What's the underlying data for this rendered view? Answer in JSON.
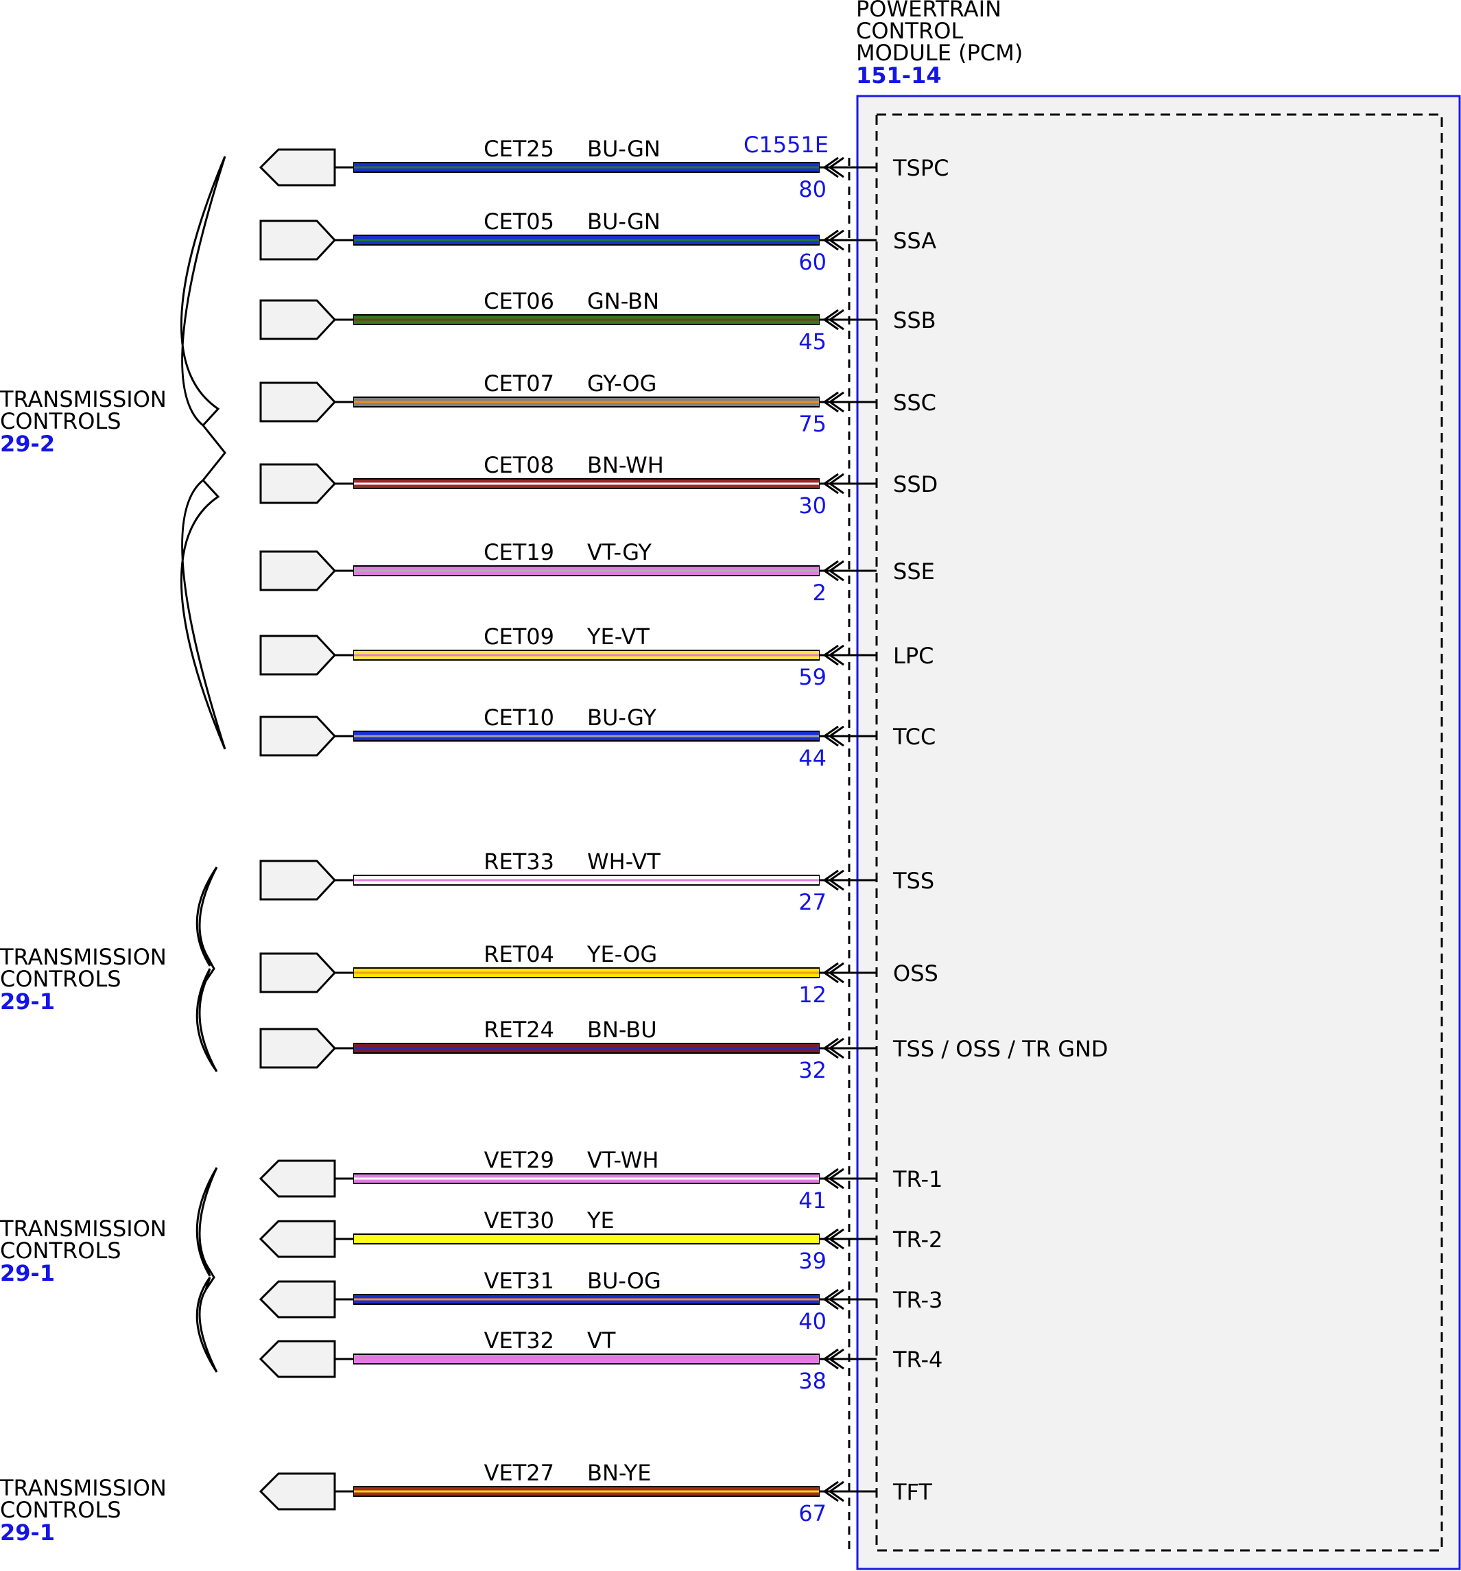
{
  "module": {
    "title_lines": [
      "POWERTRAIN",
      "CONTROL",
      "MODULE (PCM)"
    ],
    "ref": "151-14",
    "connector": "C1551E",
    "colors": {
      "border": "#1a1ae6",
      "fill": "#f2f2f2",
      "link": "#1414e6"
    }
  },
  "wires": [
    {
      "circuit": "CET25",
      "color_code": "BU-GN",
      "pin": "80",
      "signal": "TSPC",
      "dir": "left",
      "colors": [
        "#1a2fd0",
        "#1e7a2a"
      ]
    },
    {
      "circuit": "CET05",
      "color_code": "BU-GN",
      "pin": "60",
      "signal": "SSA",
      "dir": "right",
      "colors": [
        "#1a2fd0",
        "#1e7a2a"
      ]
    },
    {
      "circuit": "CET06",
      "color_code": "GN-BN",
      "pin": "45",
      "signal": "SSB",
      "dir": "right",
      "colors": [
        "#2e7d1e",
        "#7a3b1a"
      ]
    },
    {
      "circuit": "CET07",
      "color_code": "GY-OG",
      "pin": "75",
      "signal": "SSC",
      "dir": "right",
      "colors": [
        "#808080",
        "#f28c1a"
      ]
    },
    {
      "circuit": "CET08",
      "color_code": "BN-WH",
      "pin": "30",
      "signal": "SSD",
      "dir": "right",
      "colors": [
        "#9b2a2a",
        "#ffffff"
      ]
    },
    {
      "circuit": "CET19",
      "color_code": "VT-GY",
      "pin": "2",
      "signal": "SSE",
      "dir": "right",
      "colors": [
        "#e07ce0",
        "#b0b0b0"
      ]
    },
    {
      "circuit": "CET09",
      "color_code": "YE-VT",
      "pin": "59",
      "signal": "LPC",
      "dir": "right",
      "colors": [
        "#ffe640",
        "#e07ce0"
      ]
    },
    {
      "circuit": "CET10",
      "color_code": "BU-GY",
      "pin": "44",
      "signal": "TCC",
      "dir": "right",
      "colors": [
        "#1a2fd0",
        "#a0a0a0"
      ]
    },
    {
      "circuit": "RET33",
      "color_code": "WH-VT",
      "pin": "27",
      "signal": "TSS",
      "dir": "right",
      "colors": [
        "#ffffff",
        "#e07ce0"
      ]
    },
    {
      "circuit": "RET04",
      "color_code": "YE-OG",
      "pin": "12",
      "signal": "OSS",
      "dir": "right",
      "colors": [
        "#ffe600",
        "#f2a01a"
      ]
    },
    {
      "circuit": "RET24",
      "color_code": "BN-BU",
      "pin": "32",
      "signal": "TSS / OSS / TR GND",
      "dir": "right",
      "colors": [
        "#7a1a2a",
        "#2a2ab0"
      ]
    },
    {
      "circuit": "VET29",
      "color_code": "VT-WH",
      "pin": "41",
      "signal": "TR-1",
      "dir": "left",
      "colors": [
        "#e07ce0",
        "#ffffff"
      ]
    },
    {
      "circuit": "VET30",
      "color_code": "YE",
      "pin": "39",
      "signal": "TR-2",
      "dir": "left",
      "colors": [
        "#ffff1a",
        "#ffff1a"
      ]
    },
    {
      "circuit": "VET31",
      "color_code": "BU-OG",
      "pin": "40",
      "signal": "TR-3",
      "dir": "left",
      "colors": [
        "#1a2fd0",
        "#f28c1a"
      ]
    },
    {
      "circuit": "VET32",
      "color_code": "VT",
      "pin": "38",
      "signal": "TR-4",
      "dir": "left",
      "colors": [
        "#e07ce0",
        "#e07ce0"
      ]
    },
    {
      "circuit": "VET27",
      "color_code": "BN-YE",
      "pin": "67",
      "signal": "TFT",
      "dir": "left",
      "colors": [
        "#a0301a",
        "#ffd21a"
      ]
    }
  ],
  "destinations": [
    {
      "lines": [
        "TRANSMISSION",
        "CONTROLS"
      ],
      "ref": "29-2"
    },
    {
      "lines": [
        "TRANSMISSION",
        "CONTROLS"
      ],
      "ref": "29-1"
    },
    {
      "lines": [
        "TRANSMISSION",
        "CONTROLS"
      ],
      "ref": "29-1"
    },
    {
      "lines": [
        "TRANSMISSION",
        "CONTROLS"
      ],
      "ref": "29-1"
    }
  ]
}
